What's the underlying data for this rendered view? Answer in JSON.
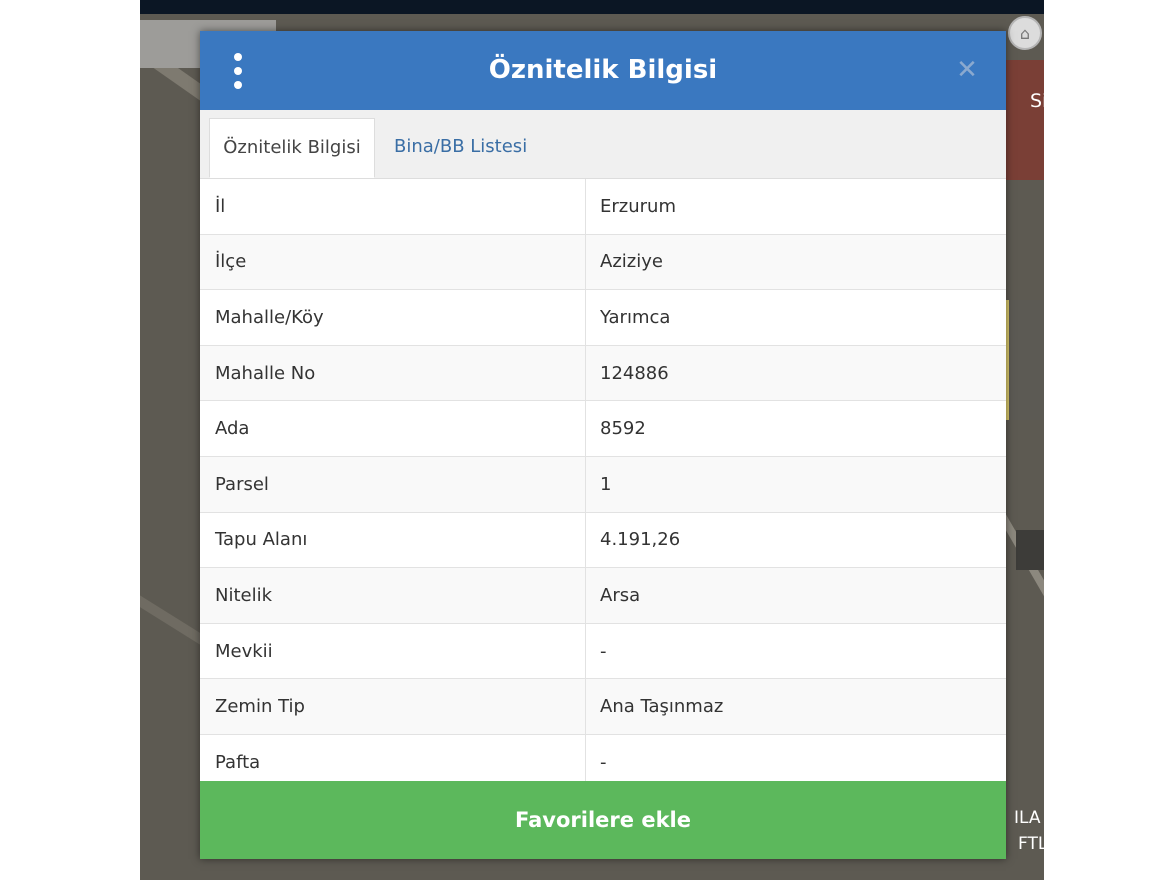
{
  "dialog": {
    "title": "Öznitelik Bilgisi",
    "close_symbol": "✕",
    "menu_icon": "vertical-dots-icon"
  },
  "tabs": [
    {
      "label": "Öznitelik Bilgisi",
      "active": true
    },
    {
      "label": "Bina/BB Listesi",
      "active": false
    }
  ],
  "rows": [
    {
      "key": "İl",
      "value": "Erzurum"
    },
    {
      "key": "İlçe",
      "value": "Aziziye"
    },
    {
      "key": "Mahalle/Köy",
      "value": "Yarımca"
    },
    {
      "key": "Mahalle No",
      "value": "124886"
    },
    {
      "key": "Ada",
      "value": "8592"
    },
    {
      "key": "Parsel",
      "value": "1"
    },
    {
      "key": "Tapu Alanı",
      "value": "4.191,26"
    },
    {
      "key": "Nitelik",
      "value": "Arsa"
    },
    {
      "key": "Mevkii",
      "value": "-"
    },
    {
      "key": "Zemin Tip",
      "value": "Ana Taşınmaz"
    },
    {
      "key": "Pafta",
      "value": "-"
    }
  ],
  "favorite_button": "Favorilere ekle",
  "map_labels": {
    "site": "Sites",
    "ila": "ILA",
    "ftl": "FTL"
  },
  "colors": {
    "header": "#3a78c0",
    "favorite": "#5cb85c",
    "tab_link": "#3a6ea5"
  }
}
